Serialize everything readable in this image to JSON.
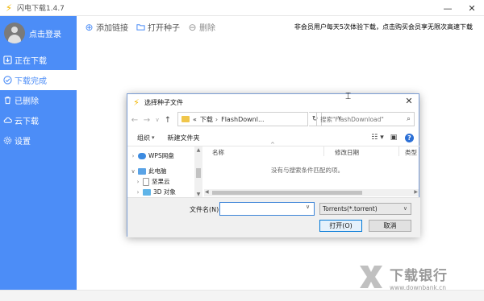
{
  "window": {
    "title": "闪电下载1.4.7",
    "app_icon": "lightning-icon",
    "controls": [
      "minimize-icon",
      "close-icon"
    ]
  },
  "sidebar": {
    "login_label": "点击登录",
    "items": [
      {
        "label": "正在下载",
        "icon": "download-icon",
        "active": false
      },
      {
        "label": "下载完成",
        "icon": "check-circle-icon",
        "active": true
      },
      {
        "label": "已删除",
        "icon": "trash-icon",
        "active": false
      },
      {
        "label": "云下载",
        "icon": "cloud-icon",
        "active": false
      },
      {
        "label": "设置",
        "icon": "gear-icon",
        "active": false
      }
    ],
    "accent_color": "#4c8df7"
  },
  "toolbar": {
    "add_link": "添加链接",
    "open_torrent": "打开种子",
    "delete": "删除",
    "promo": "非会员用户每天5次体验下载，点击购买会员享无限次高速下载"
  },
  "dialog": {
    "title": "选择种子文件",
    "breadcrumb": [
      "«",
      "下载",
      "FlashDownl..."
    ],
    "search_placeholder": "搜索\"FlashDownload\"",
    "organize": "组织",
    "new_folder": "新建文件夹",
    "tree": [
      {
        "label": "WPS网盘",
        "icon": "cloud-drive-icon"
      },
      {
        "label": "此电脑",
        "icon": "computer-icon"
      },
      {
        "label": "坚果云",
        "icon": "file-icon"
      },
      {
        "label": "3D 对象",
        "icon": "cube-icon"
      }
    ],
    "columns": [
      "名称",
      "修改日期",
      "类型"
    ],
    "empty_message": "没有与搜索条件匹配的项。",
    "filename_label": "文件名(N):",
    "filename_value": "",
    "filetype": "Torrents(*.torrent)",
    "open_button": "打开(O)",
    "cancel_button": "取消"
  },
  "watermark": {
    "text": "下载银行",
    "url": "www.downbank.cn"
  }
}
